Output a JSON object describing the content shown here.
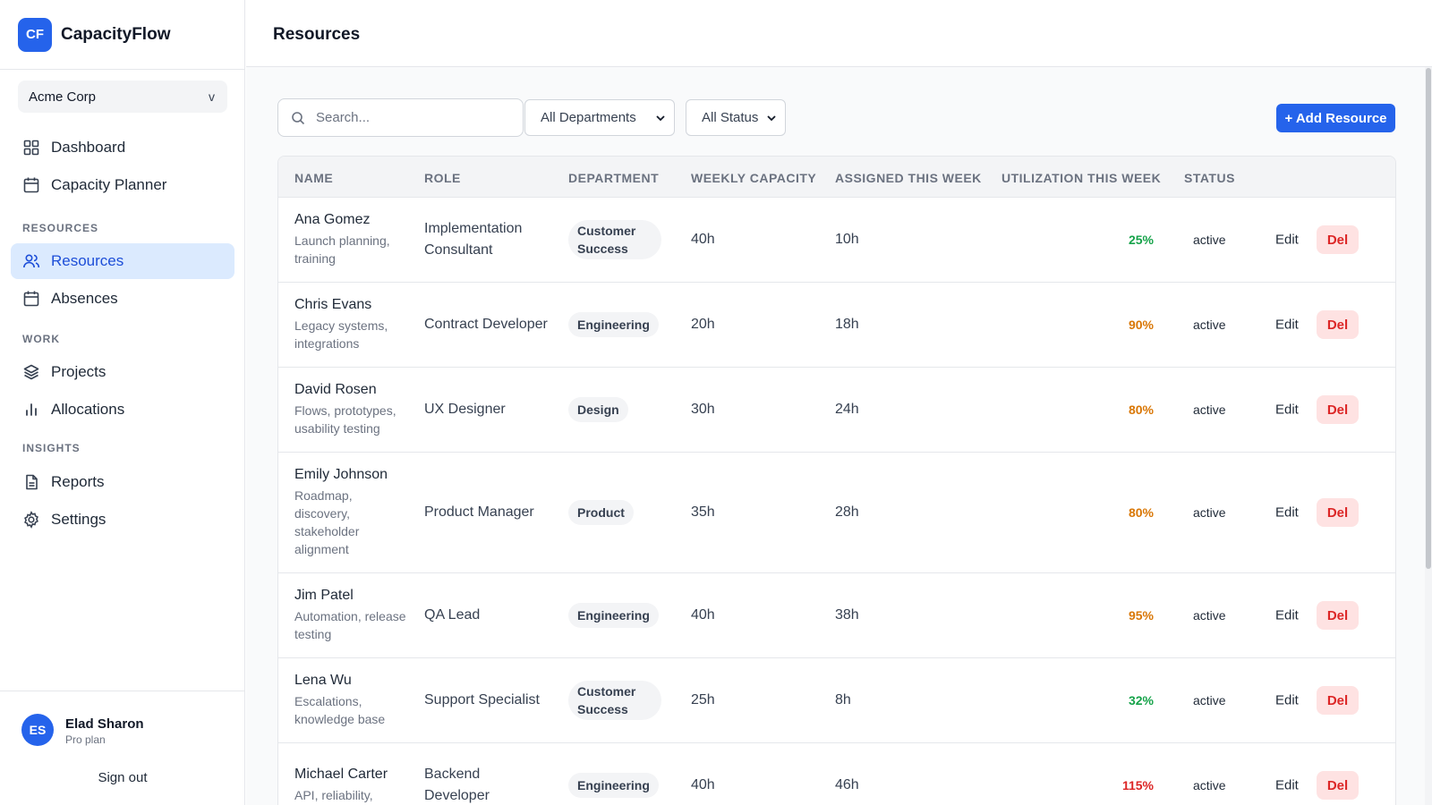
{
  "brand": {
    "logo": "CF",
    "name": "CapacityFlow"
  },
  "org": {
    "name": "Acme Corp",
    "chevron": "v"
  },
  "nav": {
    "dashboard": "Dashboard",
    "capacity_planner": "Capacity Planner",
    "section_resources": "RESOURCES",
    "resources": "Resources",
    "absences": "Absences",
    "section_work": "WORK",
    "projects": "Projects",
    "allocations": "Allocations",
    "section_insights": "INSIGHTS",
    "reports": "Reports",
    "settings": "Settings"
  },
  "user": {
    "initials": "ES",
    "name": "Elad Sharon",
    "plan": "Pro plan",
    "signout": "Sign out"
  },
  "page": {
    "title": "Resources"
  },
  "toolbar": {
    "search_placeholder": "Search...",
    "department_filter": "All Departments",
    "status_filter": "All Status",
    "add_button": "+ Add Resource"
  },
  "table": {
    "headers": {
      "name": "NAME",
      "role": "ROLE",
      "department": "DEPARTMENT",
      "weekly_capacity": "WEEKLY CAPACITY",
      "assigned": "ASSIGNED THIS WEEK",
      "utilization": "UTILIZATION THIS WEEK",
      "status": "STATUS"
    },
    "actions": {
      "edit": "Edit",
      "delete": "Del"
    },
    "rows": [
      {
        "name": "Ana Gomez",
        "desc": "Launch planning, training",
        "role": "Implementation Consultant",
        "department": "Customer Success",
        "capacity": "40h",
        "assigned": "10h",
        "utilization": "25%",
        "util_color": "#16a34a",
        "status": "active"
      },
      {
        "name": "Chris Evans",
        "desc": "Legacy systems, integrations",
        "role": "Contract Developer",
        "department": "Engineering",
        "capacity": "20h",
        "assigned": "18h",
        "utilization": "90%",
        "util_color": "#d97706",
        "status": "active"
      },
      {
        "name": "David Rosen",
        "desc": "Flows, prototypes, usability testing",
        "role": "UX Designer",
        "department": "Design",
        "capacity": "30h",
        "assigned": "24h",
        "utilization": "80%",
        "util_color": "#d97706",
        "status": "active"
      },
      {
        "name": "Emily Johnson",
        "desc": "Roadmap, discovery, stakeholder alignment",
        "role": "Product Manager",
        "department": "Product",
        "capacity": "35h",
        "assigned": "28h",
        "utilization": "80%",
        "util_color": "#d97706",
        "status": "active"
      },
      {
        "name": "Jim Patel",
        "desc": "Automation, release testing",
        "role": "QA Lead",
        "department": "Engineering",
        "capacity": "40h",
        "assigned": "38h",
        "utilization": "95%",
        "util_color": "#d97706",
        "status": "active"
      },
      {
        "name": "Lena Wu",
        "desc": "Escalations, knowledge base",
        "role": "Support Specialist",
        "department": "Customer Success",
        "capacity": "25h",
        "assigned": "8h",
        "utilization": "32%",
        "util_color": "#16a34a",
        "status": "active"
      },
      {
        "name": "Michael Carter",
        "desc": "API, reliability,",
        "role": "Backend Developer",
        "department": "Engineering",
        "capacity": "40h",
        "assigned": "46h",
        "utilization": "115%",
        "util_color": "#dc2626",
        "status": "active"
      }
    ]
  }
}
